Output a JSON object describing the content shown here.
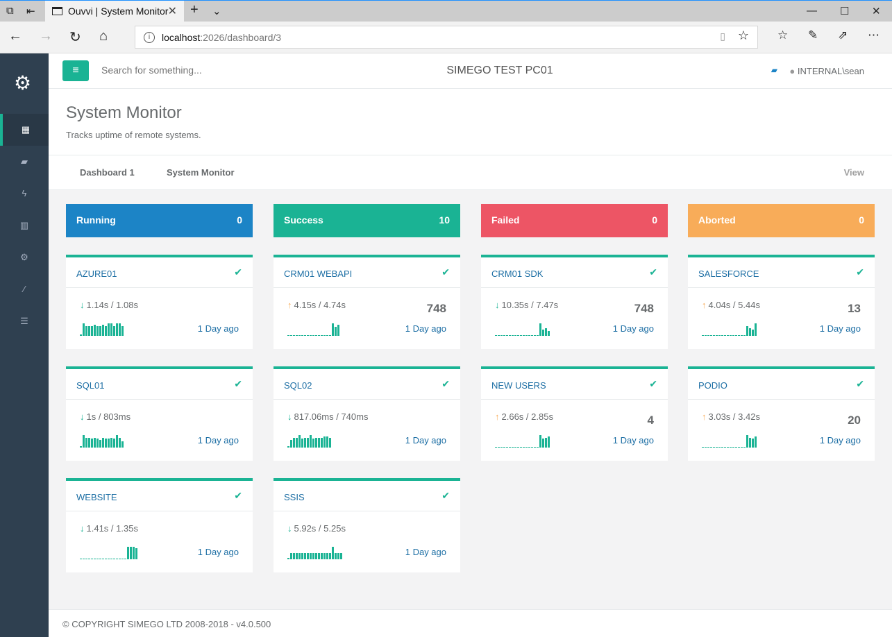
{
  "browser": {
    "tab_title": "Ouvvi | System Monitor",
    "url_host": "localhost",
    "url_path": ":2026/dashboard/3"
  },
  "header": {
    "search_placeholder": "Search for something...",
    "hostname": "SIMEGO TEST PC01",
    "user": "INTERNAL\\sean"
  },
  "page": {
    "title": "System Monitor",
    "subtitle": "Tracks uptime of remote systems."
  },
  "tabs": [
    {
      "label": "Dashboard 1"
    },
    {
      "label": "System Monitor"
    }
  ],
  "view_label": "View",
  "status": [
    {
      "label": "Running",
      "count": "0",
      "color": "#1c84c6"
    },
    {
      "label": "Success",
      "count": "10",
      "color": "#1ab394"
    },
    {
      "label": "Failed",
      "count": "0",
      "color": "#ed5565"
    },
    {
      "label": "Aborted",
      "count": "0",
      "color": "#f8ac59"
    }
  ],
  "colors": {
    "up": "#f8ac59",
    "down": "#1ab394"
  },
  "cards": [
    {
      "name": "AZURE01",
      "trend": "down",
      "timing": "1.14s / 1.08s",
      "count": "",
      "ago": "1 Day ago",
      "spark": [
        0.1,
        1,
        0.8,
        0.8,
        0.8,
        0.9,
        0.8,
        0.8,
        0.9,
        0.8,
        1,
        1,
        0.8,
        1,
        1,
        0.8
      ]
    },
    {
      "name": "CRM01 WEBAPI",
      "trend": "up",
      "timing": "4.15s / 4.74s",
      "count": "748",
      "ago": "1 Day ago",
      "spark": [
        0,
        0,
        0,
        0,
        0,
        0,
        0,
        0,
        0,
        0,
        0,
        0,
        0,
        0,
        0,
        0,
        1,
        0.7,
        0.9
      ]
    },
    {
      "name": "CRM01 SDK",
      "trend": "down",
      "timing": "10.35s / 7.47s",
      "count": "748",
      "ago": "1 Day ago",
      "spark": [
        0,
        0,
        0,
        0,
        0,
        0,
        0,
        0,
        0,
        0,
        0,
        0,
        0,
        0,
        0,
        0,
        1,
        0.5,
        0.6,
        0.4
      ]
    },
    {
      "name": "SALESFORCE",
      "trend": "up",
      "timing": "4.04s / 5.44s",
      "count": "13",
      "ago": "1 Day ago",
      "spark": [
        0,
        0,
        0,
        0,
        0,
        0,
        0,
        0,
        0,
        0,
        0,
        0,
        0,
        0,
        0,
        0,
        0.8,
        0.6,
        0.5,
        1
      ]
    },
    {
      "name": "SQL01",
      "trend": "down",
      "timing": "1s / 803ms",
      "count": "",
      "ago": "1 Day ago",
      "spark": [
        0.1,
        1,
        0.8,
        0.8,
        0.7,
        0.8,
        0.7,
        0.6,
        0.8,
        0.7,
        0.7,
        0.8,
        0.7,
        1,
        0.8,
        0.5
      ]
    },
    {
      "name": "SQL02",
      "trend": "down",
      "timing": "817.06ms / 740ms",
      "count": "",
      "ago": "1 Day ago",
      "spark": [
        0.1,
        0.6,
        0.8,
        0.8,
        1,
        0.7,
        0.8,
        0.8,
        1,
        0.7,
        0.8,
        0.8,
        0.8,
        0.9,
        0.9,
        0.8
      ]
    },
    {
      "name": "NEW USERS",
      "trend": "up",
      "timing": "2.66s / 2.85s",
      "count": "4",
      "ago": "1 Day ago",
      "spark": [
        0,
        0,
        0,
        0,
        0,
        0,
        0,
        0,
        0,
        0,
        0,
        0,
        0,
        0,
        0,
        0,
        1,
        0.7,
        0.8,
        0.9
      ]
    },
    {
      "name": "PODIO",
      "trend": "up",
      "timing": "3.03s / 3.42s",
      "count": "20",
      "ago": "1 Day ago",
      "spark": [
        0,
        0,
        0,
        0,
        0,
        0,
        0,
        0,
        0,
        0,
        0,
        0,
        0,
        0,
        0,
        0,
        1,
        0.8,
        0.7,
        0.9
      ]
    },
    {
      "name": "WEBSITE",
      "trend": "down",
      "timing": "1.41s / 1.35s",
      "count": "",
      "ago": "1 Day ago",
      "spark": [
        0,
        0,
        0,
        0,
        0,
        0,
        0,
        0,
        0,
        0,
        0,
        0,
        0,
        0,
        0,
        0,
        0,
        1,
        1,
        1,
        0.9
      ]
    },
    {
      "name": "SSIS",
      "trend": "down",
      "timing": "5.92s / 5.25s",
      "count": "",
      "ago": "1 Day ago",
      "spark": [
        0.1,
        0.5,
        0.5,
        0.5,
        0.5,
        0.5,
        0.5,
        0.5,
        0.5,
        0.5,
        0.5,
        0.5,
        0.5,
        0.5,
        0.5,
        0.5,
        1,
        0.5,
        0.5,
        0.5
      ]
    }
  ],
  "footer": "© COPYRIGHT SIMEGO LTD 2008-2018 - v4.0.500"
}
